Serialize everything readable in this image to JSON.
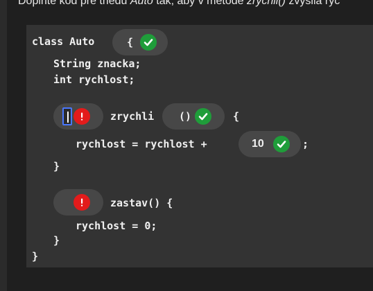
{
  "instruction": {
    "prefix": "Doplňte kód pre triedu ",
    "class_name": "Auto",
    "middle": " tak, aby v metóde ",
    "method_name": "zrychli()",
    "suffix": " zvyšila rýc"
  },
  "code": {
    "line_class": "class Auto",
    "line_field1": "String znacka;",
    "line_field2": "int rychlost;",
    "method1_name": "zrychli",
    "method1_open": "{",
    "method1_body_prefix": "rychlost = rychlost +",
    "method1_body_suffix": ";",
    "method1_close": "}",
    "method2_head": "zastav() {",
    "method2_body": "rychlost = 0;",
    "method2_close": "}",
    "class_close": "}"
  },
  "blanks": {
    "class_brace": {
      "value": "{",
      "status": "correct",
      "icon": "check-circle-icon"
    },
    "method1_modifier": {
      "value": "",
      "status": "error",
      "icon": "error-circle-icon"
    },
    "method1_params": {
      "value": "()",
      "status": "correct",
      "icon": "check-circle-icon"
    },
    "increment_value": {
      "value": "10",
      "status": "correct",
      "icon": "check-circle-icon"
    },
    "method2_modifier": {
      "value": "",
      "status": "error",
      "icon": "error-circle-icon"
    }
  },
  "colors": {
    "correct": "#1f9d3a",
    "error": "#e31b1b",
    "focus_border": "#4a78ff",
    "panel_bg": "#333333",
    "pill_bg": "#474747"
  }
}
